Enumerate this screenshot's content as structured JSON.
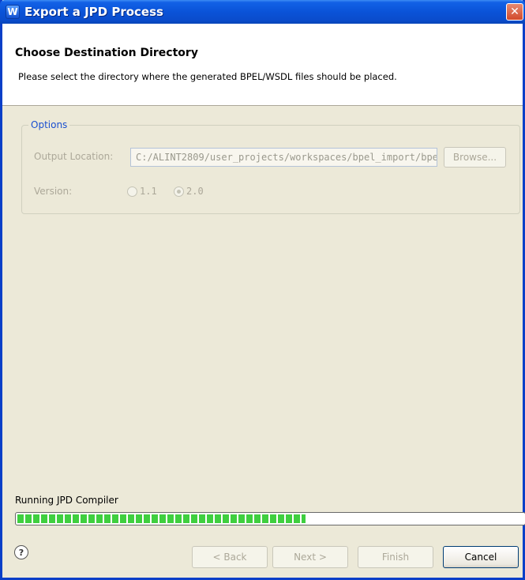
{
  "window": {
    "title": "Export a JPD Process",
    "app_icon_glyph": "W",
    "close_glyph": "✕"
  },
  "header": {
    "heading": "Choose Destination Directory",
    "description": "Please select the directory where the generated BPEL/WSDL files should be placed."
  },
  "options": {
    "legend": "Options",
    "output_location_label": "Output Location:",
    "output_location_value": "C:/ALINT2809/user_projects/workspaces/bpel_import/bpe",
    "browse_label": "Browse...",
    "version_label": "Version:",
    "version_options": [
      {
        "label": "1.1",
        "checked": false
      },
      {
        "label": "2.0",
        "checked": true
      }
    ]
  },
  "status": {
    "text": "Running JPD Compiler",
    "progress_fraction": 0.57
  },
  "buttons": {
    "help_glyph": "?",
    "back": "< Back",
    "next": "Next >",
    "finish": "Finish",
    "cancel": "Cancel"
  },
  "colors": {
    "titlebar": "#0a53d8",
    "progress_fill": "#3fcf3f",
    "legend_text": "#1a4fd0"
  }
}
